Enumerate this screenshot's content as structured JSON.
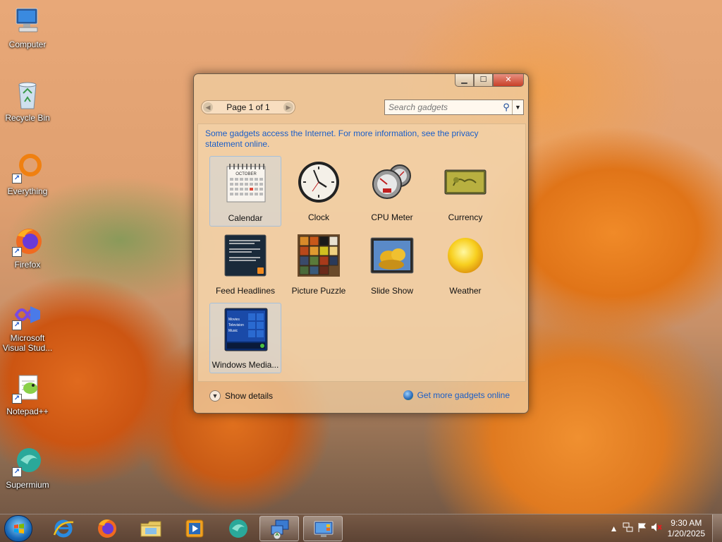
{
  "desktop": {
    "icons": [
      {
        "label": "Computer"
      },
      {
        "label": "Recycle Bin"
      },
      {
        "label": "Everything"
      },
      {
        "label": "Firefox"
      },
      {
        "label": "Microsoft Visual Stud..."
      },
      {
        "label": "Notepad++"
      },
      {
        "label": "Supermium"
      }
    ]
  },
  "gadget_window": {
    "pager": {
      "text": "Page 1 of 1"
    },
    "search": {
      "placeholder": "Search gadgets"
    },
    "notice": "Some gadgets access the Internet.  For more information, see the privacy statement online.",
    "gadgets": [
      {
        "label": "Calendar",
        "icon": "calendar-icon",
        "selected": true
      },
      {
        "label": "Clock",
        "icon": "clock-icon"
      },
      {
        "label": "CPU Meter",
        "icon": "cpu-meter-icon"
      },
      {
        "label": "Currency",
        "icon": "currency-icon"
      },
      {
        "label": "Feed Headlines",
        "icon": "feed-headlines-icon"
      },
      {
        "label": "Picture Puzzle",
        "icon": "picture-puzzle-icon"
      },
      {
        "label": "Slide Show",
        "icon": "slide-show-icon"
      },
      {
        "label": "Weather",
        "icon": "weather-icon"
      },
      {
        "label": "Windows Media...",
        "icon": "windows-media-icon",
        "selected": true
      }
    ],
    "calendar_month": "OCTOBER",
    "media_menu": [
      "Movies",
      "Television",
      "Music"
    ],
    "footer": {
      "show_details": "Show details",
      "get_more": "Get more gadgets online"
    }
  },
  "taskbar": {
    "items": [
      {
        "name": "internet-explorer"
      },
      {
        "name": "firefox"
      },
      {
        "name": "file-explorer"
      },
      {
        "name": "media-player"
      },
      {
        "name": "supermium"
      },
      {
        "name": "remote-desktop",
        "active": true
      },
      {
        "name": "gadgets-control",
        "active": true
      }
    ],
    "clock": {
      "time": "9:30 AM",
      "date": "1/20/2025"
    }
  },
  "colors": {
    "link": "#1a5ec8",
    "close_button": "#c84028"
  }
}
